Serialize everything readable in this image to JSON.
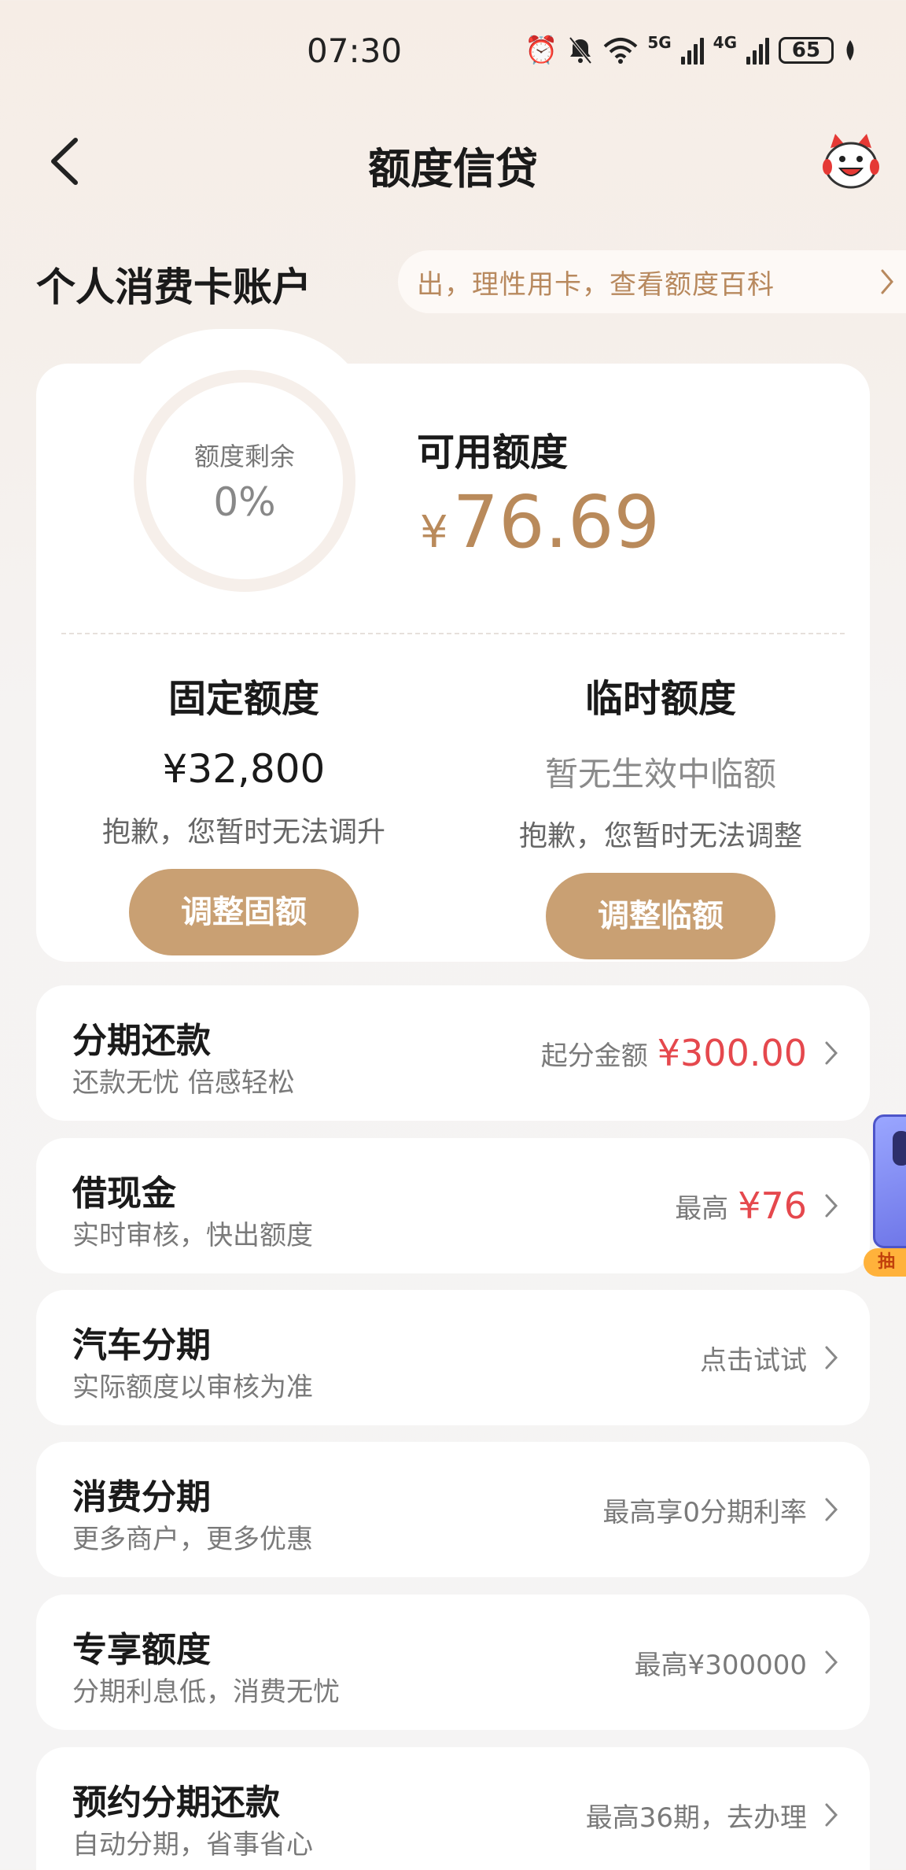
{
  "status_bar": {
    "time": "07:30",
    "network_5g": "5G",
    "network_4g": "4G",
    "battery": "65"
  },
  "nav": {
    "title": "额度信贷"
  },
  "account": {
    "title": "个人消费卡账户",
    "notice": "出，理性用卡，查看额度百科"
  },
  "summary": {
    "ring_label": "额度剩余",
    "ring_value": "0%",
    "available_label": "可用额度",
    "currency": "¥",
    "available_amount": "76.69"
  },
  "fixed": {
    "title": "固定额度",
    "amount": "¥32,800",
    "note": "抱歉，您暂时无法调升",
    "button": "调整固额"
  },
  "temp": {
    "title": "临时额度",
    "status": "暂无生效中临额",
    "note": "抱歉，您暂时无法调整",
    "button": "调整临额"
  },
  "services": [
    {
      "title": "分期还款",
      "subtitle": "还款无忧 倍感轻松",
      "hint": "起分金额",
      "amount": "¥300.00"
    },
    {
      "title": "借现金",
      "subtitle": "实时审核，快出额度",
      "hint": "最高",
      "amount": "¥76"
    },
    {
      "title": "汽车分期",
      "subtitle": "实际额度以审核为准",
      "hint": "点击试试",
      "amount": ""
    },
    {
      "title": "消费分期",
      "subtitle": "更多商户，更多优惠",
      "hint": "最高享0分期利率",
      "amount": ""
    },
    {
      "title": "专享额度",
      "subtitle": "分期利息低，消费无忧",
      "hint": "最高¥300000",
      "amount": ""
    },
    {
      "title": "预约分期还款",
      "subtitle": "自动分期，省事省心",
      "hint": "最高36期，去办理",
      "amount": ""
    }
  ],
  "float_ad": {
    "tag": "抽"
  },
  "colors": {
    "accent": "#c9a073",
    "amount_gold": "#b98a5b",
    "highlight_red": "#e5484d"
  }
}
